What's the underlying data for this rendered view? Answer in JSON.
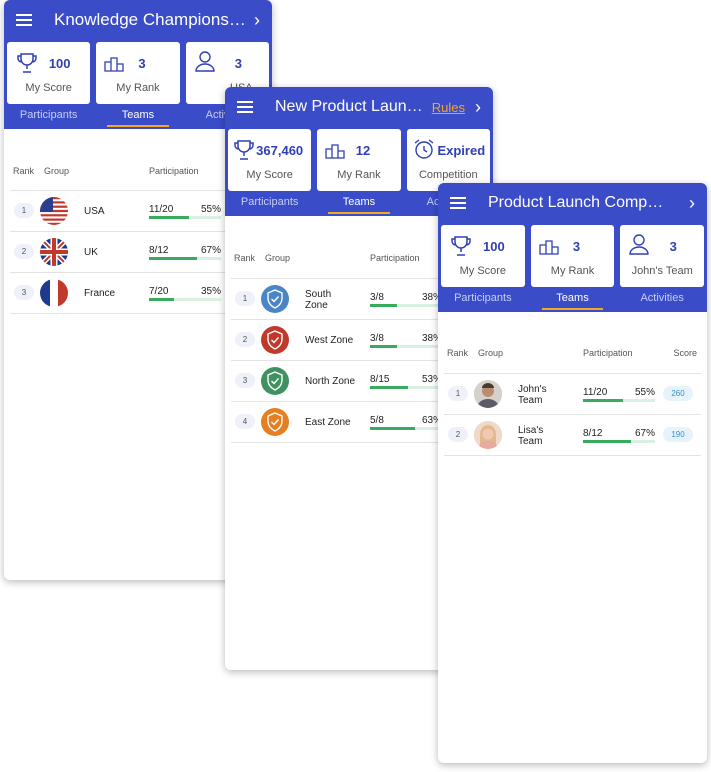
{
  "colors": {
    "header": "#3a4cc8",
    "accent": "#f5a623",
    "bar": "#3aaa5e",
    "number": "#2f3fb5"
  },
  "panel1": {
    "title": "Knowledge Champions…",
    "cards": [
      {
        "value": "100",
        "label": "My Score",
        "icon": "trophy-icon"
      },
      {
        "value": "3",
        "label": "My Rank",
        "icon": "podium-icon"
      },
      {
        "value": "3",
        "label": "USA",
        "icon": "person-icon"
      }
    ],
    "tabs": [
      "Participants",
      "Teams",
      "Activities"
    ],
    "columns": {
      "rank": "Rank",
      "group": "Group",
      "participation": "Participation"
    },
    "rows": [
      {
        "rank": "1",
        "name": "USA",
        "participation": "11/20",
        "percent": "55%",
        "progress": 0.55,
        "flag": "usa-flag-icon"
      },
      {
        "rank": "2",
        "name": "UK",
        "participation": "8/12",
        "percent": "67%",
        "progress": 0.67,
        "flag": "uk-flag-icon"
      },
      {
        "rank": "3",
        "name": "France",
        "participation": "7/20",
        "percent": "35%",
        "progress": 0.35,
        "flag": "france-flag-icon"
      }
    ]
  },
  "panel2": {
    "title": "New Product Laun…",
    "rules": "Rules",
    "cards": [
      {
        "value": "367,460",
        "label": "My Score",
        "icon": "trophy-icon"
      },
      {
        "value": "12",
        "label": "My Rank",
        "icon": "podium-icon"
      },
      {
        "value": "Expired",
        "label": "Competition",
        "icon": "alarm-clock-icon"
      }
    ],
    "tabs": [
      "Participants",
      "Teams",
      "Activities"
    ],
    "columns": {
      "rank": "Rank",
      "group": "Group",
      "participation": "Participation"
    },
    "rows": [
      {
        "rank": "1",
        "name": "South Zone",
        "participation": "3/8",
        "percent": "38%",
        "progress": 0.38,
        "color": "#4a86c5"
      },
      {
        "rank": "2",
        "name": "West Zone",
        "participation": "3/8",
        "percent": "38%",
        "progress": 0.38,
        "color": "#c0392b"
      },
      {
        "rank": "3",
        "name": "North Zone",
        "participation": "8/15",
        "percent": "53%",
        "progress": 0.53,
        "color": "#3f9161"
      },
      {
        "rank": "4",
        "name": "East Zone",
        "participation": "5/8",
        "percent": "63%",
        "progress": 0.63,
        "color": "#e67e22"
      }
    ]
  },
  "panel3": {
    "title": "Product Launch Comp…",
    "cards": [
      {
        "value": "100",
        "label": "My Score",
        "icon": "trophy-icon"
      },
      {
        "value": "3",
        "label": "My Rank",
        "icon": "podium-icon"
      },
      {
        "value": "3",
        "label": "John's Team",
        "icon": "person-icon"
      }
    ],
    "tabs": [
      "Participants",
      "Teams",
      "Activities"
    ],
    "columns": {
      "rank": "Rank",
      "group": "Group",
      "participation": "Participation",
      "score": "Score"
    },
    "rows": [
      {
        "rank": "1",
        "name": "John's Team",
        "participation": "11/20",
        "percent": "55%",
        "progress": 0.55,
        "score": "260"
      },
      {
        "rank": "2",
        "name": "Lisa's Team",
        "participation": "8/12",
        "percent": "67%",
        "progress": 0.67,
        "score": "190"
      }
    ]
  }
}
